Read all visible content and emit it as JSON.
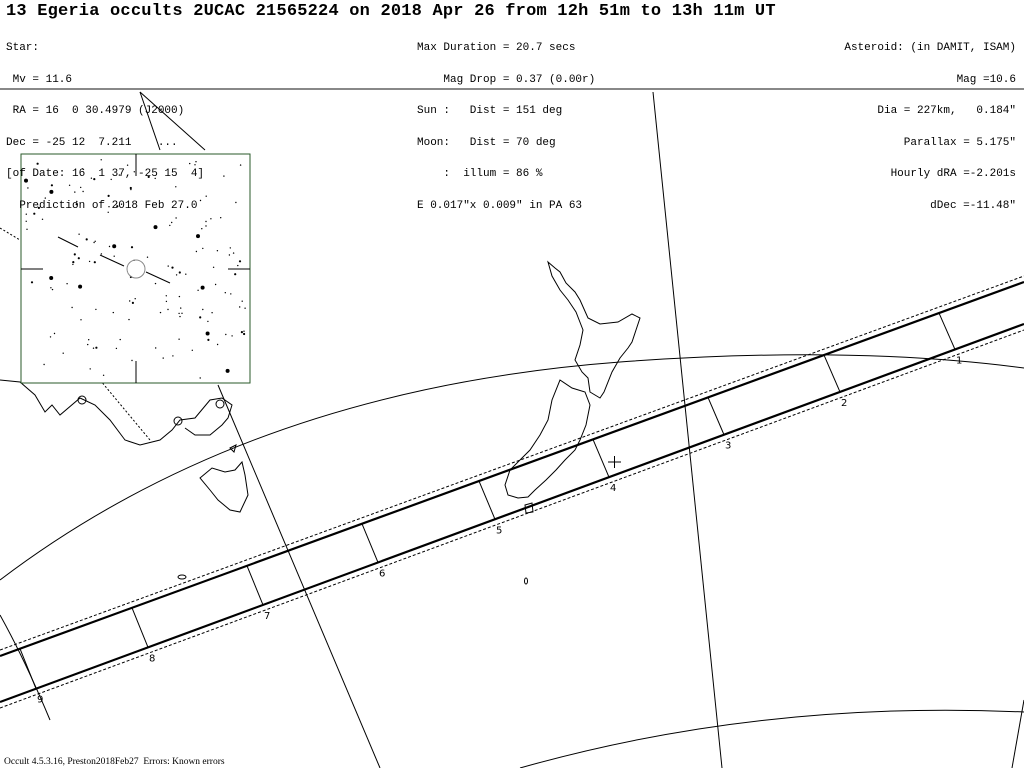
{
  "title": "13 Egeria occults 2UCAC 21565224 on 2018 Apr 26 from 12h 51m to 13h 11m UT",
  "star_block": [
    "Star:",
    " Mv = 11.6",
    " RA = 16  0 30.4979 (J2000)",
    "Dec = -25 12  7.211    ...",
    "[of Date: 16  1 37, -25 15  4]",
    "  Prediction of 2018 Feb 27.0"
  ],
  "event_block": [
    "Max Duration = 20.7 secs",
    "    Mag Drop = 0.37 (0.00r)",
    "Sun :   Dist = 151 deg",
    "Moon:   Dist = 70 deg",
    "    :  illum = 86 %",
    "E 0.017\"x 0.009\" in PA 63"
  ],
  "asteroid_block": [
    "Asteroid: (in DAMIT, ISAM)",
    "Mag =10.6",
    "Dia = 227km,   0.184\"",
    "Parallax = 5.175\"",
    "Hourly dRA =-2.201s",
    "dDec =-11.48\""
  ],
  "time_ticks": [
    "1",
    "2",
    "3",
    "4",
    "5",
    "6",
    "7",
    "8",
    "9"
  ],
  "footer": "Occult 4.5.3.16, Preston2018Feb27  Errors: Known errors",
  "colors": {
    "path": "#000000",
    "coast": "#000000",
    "separator": "#888888",
    "inset_border": "#2a5a2a"
  }
}
